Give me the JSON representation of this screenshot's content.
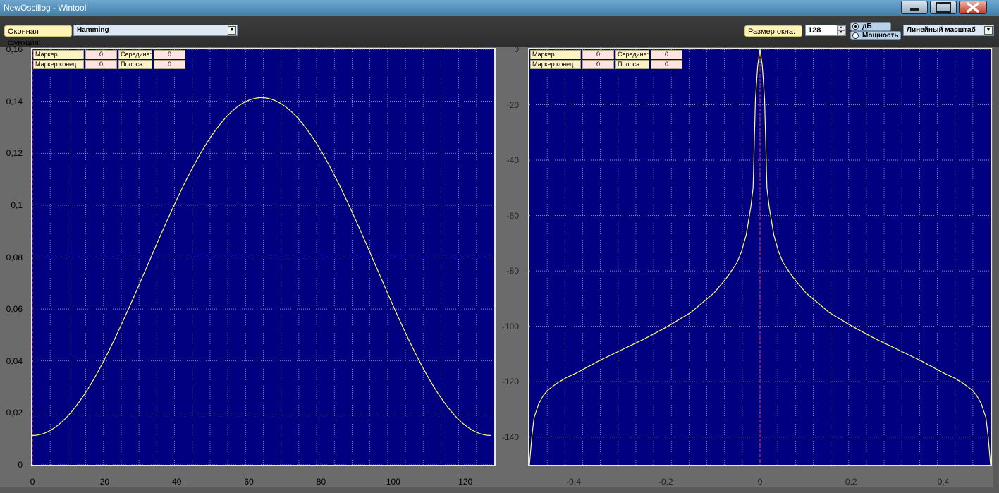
{
  "window": {
    "title": "NewOscillog - Wintool"
  },
  "toolbar": {
    "window_func_label": "Оконная функция:",
    "window_func_value": "Hamming",
    "window_size_label": "Размер окна:",
    "window_size_value": "128",
    "db_label": "дБ",
    "power_label": "Мощность",
    "scale_value": "Линейный масштаб"
  },
  "markers": {
    "start_label": "Маркер начало:",
    "end_label": "Маркер конец:",
    "middle_label": "Середина:",
    "band_label": "Полоса:",
    "left": {
      "start": "0",
      "end": "0",
      "middle": "0",
      "band": "0"
    },
    "right": {
      "start": "0",
      "end": "0",
      "middle": "0",
      "band": "0"
    }
  },
  "colors": {
    "plot_bg": "#000080",
    "curve": "#ffff66",
    "marker": "#ff3333",
    "grid": "#c8c8c8"
  },
  "chart_data": [
    {
      "type": "line",
      "xlim": [
        0,
        128
      ],
      "ylim": [
        0,
        0.16
      ],
      "x_ticks": [
        "0",
        "20",
        "40",
        "60",
        "80",
        "100",
        "120"
      ],
      "y_ticks": [
        "0",
        "0,02",
        "0,04",
        "0,06",
        "0,08",
        "0,1",
        "0,12",
        "0,14",
        "0,16"
      ],
      "grid": true,
      "window": "hamming",
      "n_points": 128,
      "peak_value": 0.1414,
      "edge_value": 0.0113,
      "marker_x": 0
    },
    {
      "type": "line",
      "xlim": [
        -0.5,
        0.5
      ],
      "ylim": [
        -150,
        0
      ],
      "x_ticks": [
        "-0,4",
        "-0,2",
        "0",
        "0,2",
        "0,4"
      ],
      "y_ticks": [
        "0",
        "-20",
        "-40",
        "-60",
        "-80",
        "-100",
        "-120",
        "-140"
      ],
      "grid": true,
      "x": [
        -0.5,
        -0.495,
        -0.49,
        -0.48,
        -0.47,
        -0.46,
        -0.44,
        -0.42,
        -0.4,
        -0.35,
        -0.3,
        -0.25,
        -0.2,
        -0.15,
        -0.1,
        -0.07,
        -0.05,
        -0.04,
        -0.03,
        -0.02,
        -0.015,
        -0.01,
        -0.005,
        0,
        0.005,
        0.01,
        0.015,
        0.02,
        0.03,
        0.04,
        0.05,
        0.07,
        0.1,
        0.15,
        0.2,
        0.25,
        0.3,
        0.35,
        0.4,
        0.42,
        0.44,
        0.46,
        0.47,
        0.48,
        0.49,
        0.495,
        0.5
      ],
      "y": [
        -150,
        -140,
        -133,
        -128,
        -125,
        -123,
        -120.5,
        -118.5,
        -117,
        -112.5,
        -108.5,
        -104.5,
        -100,
        -95,
        -88,
        -82,
        -77,
        -73,
        -67,
        -57,
        -50,
        -18,
        -6,
        0,
        -6,
        -18,
        -50,
        -57,
        -67,
        -73,
        -77,
        -82,
        -88,
        -95,
        -100,
        -104.5,
        -108.5,
        -112.5,
        -117,
        -118.5,
        -120.5,
        -123,
        -125,
        -128,
        -133,
        -140,
        -150
      ],
      "marker_x": 0
    }
  ]
}
